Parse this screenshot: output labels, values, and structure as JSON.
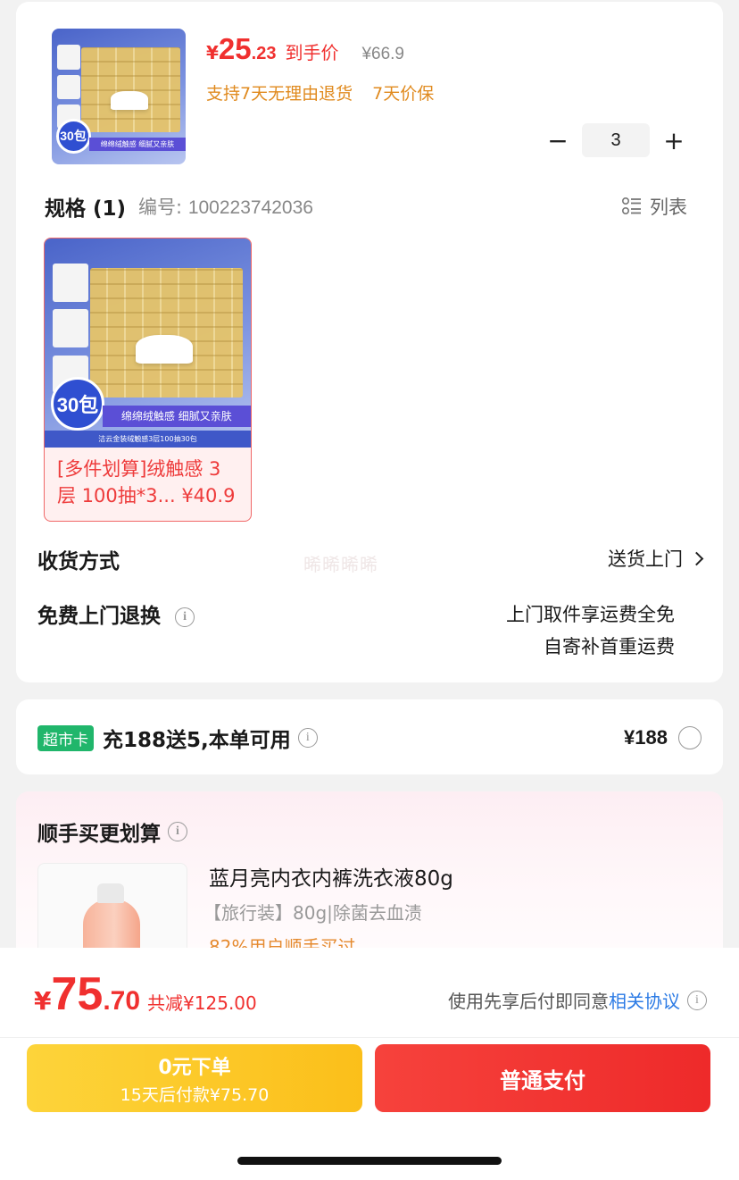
{
  "product": {
    "thumb_badge": "30包",
    "thumb_banner": "绵绵绒触感 细腻又亲肤",
    "price_symbol": "¥",
    "price_int": "25",
    "price_dec": ".23",
    "price_tag": "到手价",
    "original_price": "¥66.9",
    "services": [
      "支持7天无理由退货",
      "7天价保"
    ],
    "quantity": "3",
    "minus_label": "−",
    "plus_label": "+"
  },
  "spec": {
    "title": "规格 (1)",
    "code_label": "编号:",
    "code_value": "100223742036",
    "list_label": "列表",
    "option_badge": "30包",
    "option_banner": "绵绵绒触感 细腻又亲肤",
    "option_footer": "洁云金装绒触感3层100抽30包",
    "option_label": "[多件划算]绒触感 3层 100抽*3... ¥40.9"
  },
  "delivery": {
    "label": "收货方式",
    "value": "送货上门",
    "watermark": "晞晞晞晞"
  },
  "returns": {
    "label": "免费上门退换",
    "value_line1": "上门取件享运费全免",
    "value_line2": "自寄补首重运费"
  },
  "super_card": {
    "badge": "超市卡",
    "text": "充188送5,本单可用",
    "price": "¥188"
  },
  "bundle": {
    "title": "顺手买更划算",
    "item_name": "蓝月亮内衣内裤洗衣液80g",
    "item_desc": "【旅行装】80g|除菌去血渍",
    "item_stat": "82%用户顺手买过"
  },
  "footer": {
    "total_symbol": "¥",
    "total_int": "75",
    "total_dec": ".70",
    "total_saved": "共减¥125.00",
    "agree_text": "使用先享后付即同意",
    "agree_link": "相关协议",
    "later_line1": "0元下单",
    "later_line2": "15天后付款¥75.70",
    "pay_label": "普通支付"
  },
  "colors": {
    "accent_red": "#f0302f",
    "service_orange": "#e08a1e",
    "supercard_green": "#20b66b",
    "link_blue": "#2c7be5",
    "later_yellow": "#fbbf1a"
  }
}
